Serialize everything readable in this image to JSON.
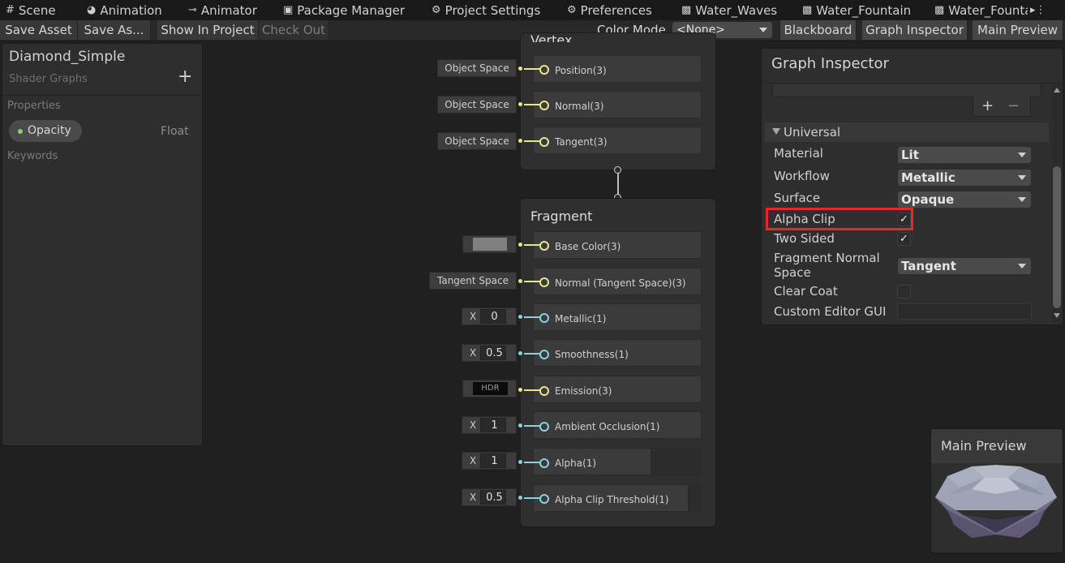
{
  "tabs": [
    {
      "icon": "hash-icon",
      "label": "Scene"
    },
    {
      "icon": "animation-icon",
      "label": "Animation"
    },
    {
      "icon": "animator-icon",
      "label": "Animator"
    },
    {
      "icon": "package-icon",
      "label": "Package Manager"
    },
    {
      "icon": "gear-icon",
      "label": "Project Settings"
    },
    {
      "icon": "gear-icon",
      "label": "Preferences"
    },
    {
      "icon": "shadergraph-icon",
      "label": "Water_Waves"
    },
    {
      "icon": "shadergraph-icon",
      "label": "Water_Fountain"
    },
    {
      "icon": "shadergraph-icon",
      "label": "Water_Founta"
    }
  ],
  "tab_overflow": "▸⋮",
  "toolbar": {
    "save_asset": "Save Asset",
    "save_as": "Save As...",
    "show_in_project": "Show In Project",
    "check_out": "Check Out",
    "color_mode_label": "Color Mode",
    "color_mode_value": "<None>",
    "blackboard": "Blackboard",
    "graph_inspector": "Graph Inspector",
    "main_preview": "Main Preview"
  },
  "blackboard": {
    "title": "Diamond_Simple",
    "subtitle": "Shader Graphs",
    "add": "+",
    "properties_header": "Properties",
    "property": {
      "name": "Opacity",
      "type": "Float"
    },
    "keywords_header": "Keywords"
  },
  "vertex": {
    "title": "Vertex",
    "slots": [
      {
        "label": "Position(3)",
        "input": "Object Space"
      },
      {
        "label": "Normal(3)",
        "input": "Object Space"
      },
      {
        "label": "Tangent(3)",
        "input": "Object Space"
      }
    ]
  },
  "fragment": {
    "title": "Fragment",
    "slots": [
      {
        "label": "Base Color(3)",
        "input_kind": "color",
        "color": "#808080"
      },
      {
        "label": "Normal (Tangent Space)(3)",
        "input_kind": "text",
        "input": "Tangent Space"
      },
      {
        "label": "Metallic(1)",
        "input_kind": "x",
        "x": "X",
        "value": "0"
      },
      {
        "label": "Smoothness(1)",
        "input_kind": "x",
        "x": "X",
        "value": "0.5"
      },
      {
        "label": "Emission(3)",
        "input_kind": "hdr",
        "input": "HDR"
      },
      {
        "label": "Ambient Occlusion(1)",
        "input_kind": "x",
        "x": "X",
        "value": "1"
      },
      {
        "label": "Alpha(1)",
        "input_kind": "x",
        "x": "X",
        "value": "1"
      },
      {
        "label": "Alpha Clip Threshold(1)",
        "input_kind": "x",
        "x": "X",
        "value": "0.5"
      }
    ]
  },
  "graph_inspector": {
    "title": "Graph Inspector",
    "plus": "+",
    "minus": "−",
    "section": "Universal",
    "material_label": "Material",
    "material_value": "Lit",
    "workflow_label": "Workflow",
    "workflow_value": "Metallic",
    "surface_label": "Surface",
    "surface_value": "Opaque",
    "alpha_clip_label": "Alpha Clip",
    "alpha_clip_checked": "✓",
    "two_sided_label": "Two Sided",
    "two_sided_checked": "✓",
    "fragment_normal_label_1": "Fragment Normal",
    "fragment_normal_label_2": "Space",
    "fragment_normal_value": "Tangent",
    "clear_coat_label": "Clear Coat",
    "custom_editor_label": "Custom Editor GUI",
    "custom_editor_value": ""
  },
  "main_preview": {
    "title": "Main Preview"
  },
  "colors": {
    "highlight": "#e12b2b",
    "vector_port": "#e7e58f",
    "float_port": "#85d4e0"
  }
}
